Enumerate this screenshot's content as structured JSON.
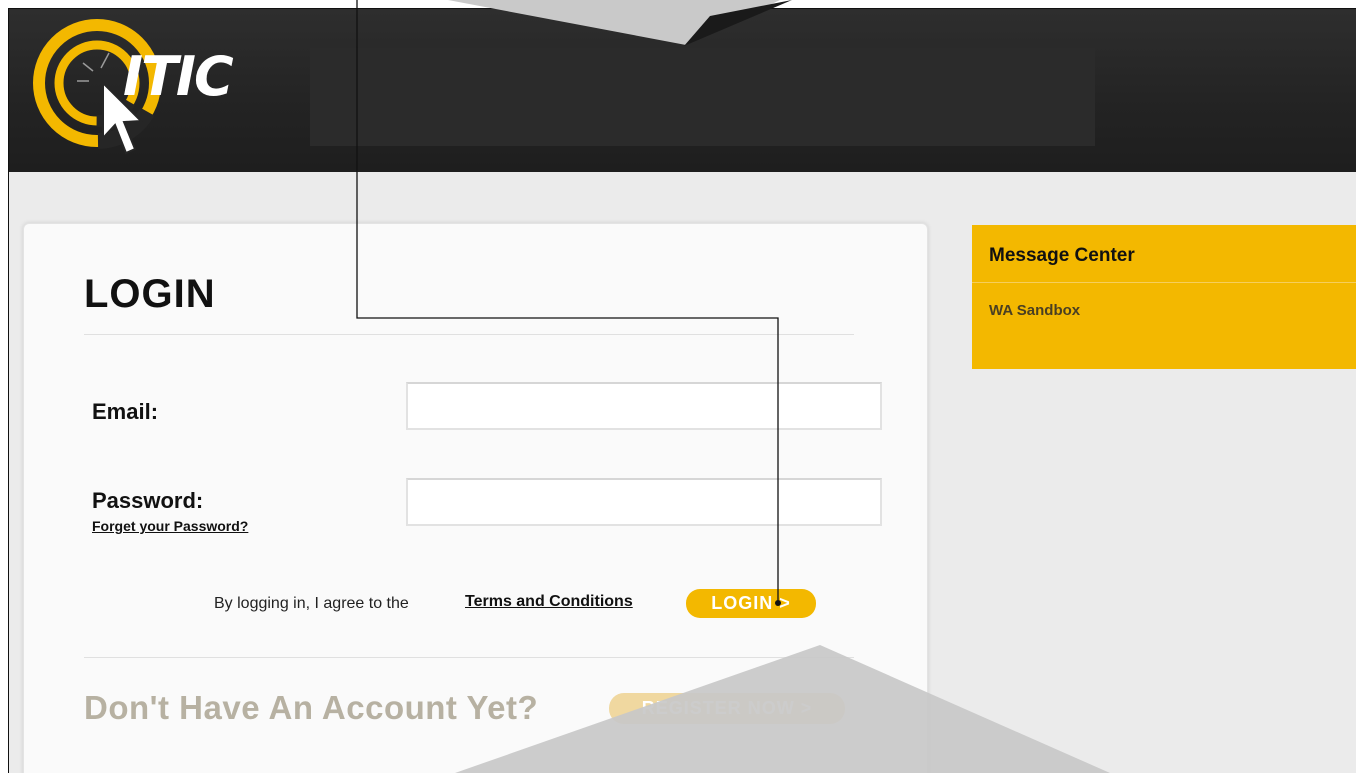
{
  "header": {
    "logo_text": "ITIC"
  },
  "login": {
    "title": "LOGIN",
    "email_label": "Email:",
    "email_value": "",
    "password_label": "Password:",
    "password_value": "",
    "forgot_link": "Forget your Password?",
    "agree_text": "By logging in, I agree to the",
    "terms_link": "Terms and Conditions",
    "login_button": "LOGIN >",
    "no_account_text": "Don't Have An Account Yet?",
    "register_button": "REGISTER NOW >"
  },
  "message_center": {
    "title": "Message Center",
    "items": [
      "WA Sandbox"
    ]
  },
  "colors": {
    "header_bg": "#262626",
    "accent": "#f3b800",
    "page_bg": "#ebebeb",
    "callout_gray": "#c8c8c8"
  },
  "icons": {
    "logo": "itic-target-cursor-logo"
  }
}
